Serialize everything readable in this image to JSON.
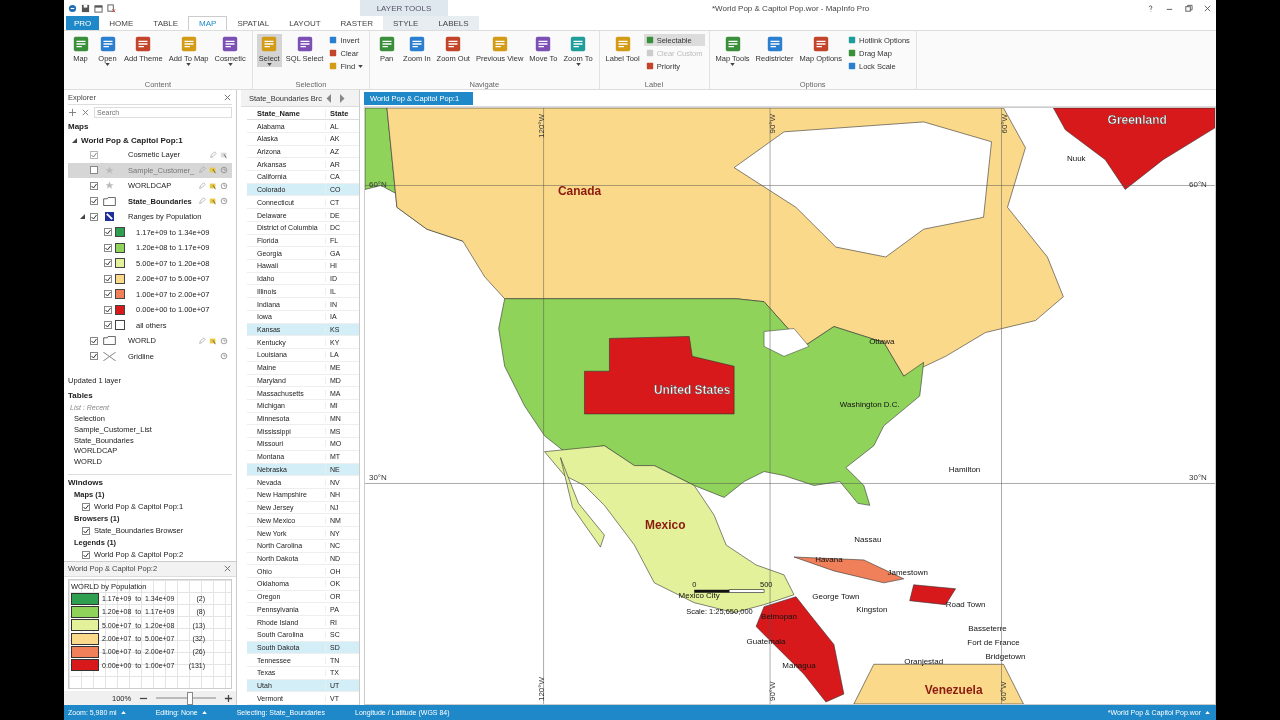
{
  "title_bar": {
    "title": "*World Pop & Capitol Pop.wor - MapInfo Pro",
    "context_group": "LAYER TOOLS"
  },
  "ribbon_tabs": [
    {
      "label": "PRO",
      "kind": "file",
      "selected": false
    },
    {
      "label": "HOME",
      "kind": "main",
      "selected": false
    },
    {
      "label": "TABLE",
      "kind": "main",
      "selected": false
    },
    {
      "label": "MAP",
      "kind": "main",
      "selected": true
    },
    {
      "label": "SPATIAL",
      "kind": "main",
      "selected": false
    },
    {
      "label": "LAYOUT",
      "kind": "main",
      "selected": false
    },
    {
      "label": "RASTER",
      "kind": "main",
      "selected": false
    },
    {
      "label": "STYLE",
      "kind": "context",
      "selected": false
    },
    {
      "label": "LABELS",
      "kind": "context",
      "selected": false
    }
  ],
  "ribbon_groups": [
    {
      "label": "Content",
      "buttons": [
        {
          "label": "Map",
          "kind": "large",
          "selected": false,
          "disabled": false,
          "dropdown": false
        },
        {
          "label": "Open",
          "kind": "large",
          "selected": false,
          "disabled": false,
          "dropdown": true
        },
        {
          "label": "Add Theme",
          "kind": "large",
          "selected": false,
          "disabled": false,
          "dropdown": false
        },
        {
          "label": "Add To Map",
          "kind": "large",
          "selected": false,
          "disabled": false,
          "dropdown": true
        },
        {
          "label": "Cosmetic",
          "kind": "large",
          "selected": false,
          "disabled": false,
          "dropdown": true
        }
      ]
    },
    {
      "label": "Selection",
      "buttons": [
        {
          "label": "Select",
          "kind": "large",
          "selected": true,
          "disabled": false,
          "dropdown": true
        },
        {
          "label": "SQL Select",
          "kind": "large",
          "selected": false,
          "disabled": false,
          "dropdown": false
        },
        {
          "label": "Invert",
          "kind": "small",
          "selected": false,
          "disabled": false,
          "dropdown": false
        },
        {
          "label": "Clear",
          "kind": "small",
          "selected": false,
          "disabled": false,
          "dropdown": false
        },
        {
          "label": "Find",
          "kind": "small",
          "selected": false,
          "disabled": false,
          "dropdown": true
        }
      ]
    },
    {
      "label": "Navigate",
      "buttons": [
        {
          "label": "Pan",
          "kind": "large",
          "selected": false,
          "disabled": false,
          "dropdown": false
        },
        {
          "label": "Zoom In",
          "kind": "large",
          "selected": false,
          "disabled": false,
          "dropdown": false
        },
        {
          "label": "Zoom Out",
          "kind": "large",
          "selected": false,
          "disabled": false,
          "dropdown": false
        },
        {
          "label": "Previous View",
          "kind": "large",
          "selected": false,
          "disabled": false,
          "dropdown": false
        },
        {
          "label": "Move To",
          "kind": "large",
          "selected": false,
          "disabled": false,
          "dropdown": false
        },
        {
          "label": "Zoom To",
          "kind": "large",
          "selected": false,
          "disabled": false,
          "dropdown": true
        }
      ]
    },
    {
      "label": "Label",
      "buttons": [
        {
          "label": "Label Tool",
          "kind": "large",
          "selected": false,
          "disabled": false,
          "dropdown": false
        },
        {
          "label": "Selectable",
          "kind": "small",
          "selected": true,
          "disabled": false,
          "dropdown": false
        },
        {
          "label": "Clear Custom",
          "kind": "small",
          "selected": false,
          "disabled": true,
          "dropdown": false
        },
        {
          "label": "Priority",
          "kind": "small",
          "selected": false,
          "disabled": false,
          "dropdown": false
        }
      ]
    },
    {
      "label": "Options",
      "buttons": [
        {
          "label": "Map Tools",
          "kind": "large",
          "selected": false,
          "disabled": false,
          "dropdown": true
        },
        {
          "label": "Redistricter",
          "kind": "large",
          "selected": false,
          "disabled": false,
          "dropdown": false
        },
        {
          "label": "Map Options",
          "kind": "large",
          "selected": false,
          "disabled": false,
          "dropdown": false
        },
        {
          "label": "Hotlink Options",
          "kind": "small",
          "selected": false,
          "disabled": false,
          "dropdown": false
        },
        {
          "label": "Drag Map",
          "kind": "small",
          "selected": false,
          "disabled": false,
          "dropdown": false
        },
        {
          "label": "Lock Scale",
          "kind": "small",
          "selected": false,
          "disabled": false,
          "dropdown": false
        }
      ]
    }
  ],
  "explorer": {
    "title": "Explorer",
    "search": {
      "placeholder": "Search"
    },
    "maps_header": "Maps",
    "map": {
      "label": "World Pop & Capitol Pop:1",
      "expanded": true,
      "layers": [
        {
          "label": "Cosmetic Layer",
          "kind": "cosmetic",
          "checked": true,
          "selected": false,
          "editable": false
        },
        {
          "label": "Sample_Customer_",
          "kind": "point",
          "checked": false,
          "selected": true,
          "editable": false
        },
        {
          "label": "WORLDCAP",
          "kind": "point",
          "checked": true,
          "selected": false,
          "editable": false
        },
        {
          "label": "State_Boundaries",
          "kind": "region",
          "checked": true,
          "selected": false,
          "editable": true
        },
        {
          "label": "Ranges by Population",
          "kind": "theme",
          "checked": true,
          "selected": false,
          "editable": false,
          "expanded": true,
          "children": [
            {
              "label": "1.17e+09 to 1.34e+09",
              "color": "#2e9e4f",
              "checked": true
            },
            {
              "label": "1.20e+08 to 1.17e+09",
              "color": "#8fd35a",
              "checked": true
            },
            {
              "label": "5.00e+07 to 1.20e+08",
              "color": "#e3f29a",
              "checked": true
            },
            {
              "label": "2.00e+07 to 5.00e+07",
              "color": "#fbd98a",
              "checked": true
            },
            {
              "label": "1.00e+07 to 2.00e+07",
              "color": "#f0805a",
              "checked": true
            },
            {
              "label": "0.00e+00 to 1.00e+07",
              "color": "#d7191c",
              "checked": true
            },
            {
              "label": "all others",
              "color": "#ffffff",
              "checked": true
            }
          ]
        },
        {
          "label": "WORLD",
          "kind": "region",
          "checked": true,
          "selected": false,
          "editable": false
        },
        {
          "label": "Gridline",
          "kind": "gridline",
          "checked": true,
          "selected": false,
          "editable": false
        }
      ]
    },
    "message": "Updated 1 layer",
    "tables_header": "Tables",
    "tables_list_mode": "List : Recent",
    "tables": [
      "Selection",
      "Sample_Customer_List",
      "State_Boundaries",
      "WORLDCAP",
      "WORLD"
    ],
    "windows_header": "Windows",
    "window_groups": [
      {
        "label": "Maps (1)",
        "items": [
          {
            "label": "World Pop & Capitol Pop:1",
            "checked": true
          }
        ]
      },
      {
        "label": "Browsers (1)",
        "items": [
          {
            "label": "State_Boundaries Browser",
            "checked": true
          }
        ]
      },
      {
        "label": "Legends (1)",
        "items": [
          {
            "label": "World Pop & Capitol Pop:2",
            "checked": true
          }
        ]
      }
    ]
  },
  "legend": {
    "title": "World Pop & Capitol Pop:2",
    "heading": "WORLD by Population",
    "rows": [
      {
        "color": "#2e9e4f",
        "range": "1.17e+09  to  1.34e+09",
        "count": "(2)"
      },
      {
        "color": "#8fd35a",
        "range": "1.20e+08  to  1.17e+09",
        "count": "(8)"
      },
      {
        "color": "#e3f29a",
        "range": "5.00e+07  to  1.20e+08",
        "count": "(13)"
      },
      {
        "color": "#fbd98a",
        "range": "2.00e+07  to  5.00e+07",
        "count": "(32)"
      },
      {
        "color": "#f0805a",
        "range": "1.00e+07  to  2.00e+07",
        "count": "(26)"
      },
      {
        "color": "#d7191c",
        "range": "0.00e+00  to  1.00e+07",
        "count": "(131)"
      }
    ],
    "zoom": "100%",
    "zoom_slider": {
      "level": 0.55
    }
  },
  "browser": {
    "tab": "State_Boundaries Brc",
    "columns": [
      "State_Name",
      "State"
    ],
    "rows": [
      {
        "name": "Alabama",
        "code": "AL",
        "selected": false
      },
      {
        "name": "Alaska",
        "code": "AK",
        "selected": false
      },
      {
        "name": "Arizona",
        "code": "AZ",
        "selected": false
      },
      {
        "name": "Arkansas",
        "code": "AR",
        "selected": false
      },
      {
        "name": "California",
        "code": "CA",
        "selected": false
      },
      {
        "name": "Colorado",
        "code": "CO",
        "selected": true
      },
      {
        "name": "Connecticut",
        "code": "CT",
        "selected": false
      },
      {
        "name": "Delaware",
        "code": "DE",
        "selected": false
      },
      {
        "name": "District of Columbia",
        "code": "DC",
        "selected": false
      },
      {
        "name": "Florida",
        "code": "FL",
        "selected": false
      },
      {
        "name": "Georgia",
        "code": "GA",
        "selected": false
      },
      {
        "name": "Hawaii",
        "code": "HI",
        "selected": false
      },
      {
        "name": "Idaho",
        "code": "ID",
        "selected": false
      },
      {
        "name": "Illinois",
        "code": "IL",
        "selected": false
      },
      {
        "name": "Indiana",
        "code": "IN",
        "selected": false
      },
      {
        "name": "Iowa",
        "code": "IA",
        "selected": false
      },
      {
        "name": "Kansas",
        "code": "KS",
        "selected": true
      },
      {
        "name": "Kentucky",
        "code": "KY",
        "selected": false
      },
      {
        "name": "Louisiana",
        "code": "LA",
        "selected": false
      },
      {
        "name": "Maine",
        "code": "ME",
        "selected": false
      },
      {
        "name": "Maryland",
        "code": "MD",
        "selected": false
      },
      {
        "name": "Massachusetts",
        "code": "MA",
        "selected": false
      },
      {
        "name": "Michigan",
        "code": "MI",
        "selected": false
      },
      {
        "name": "Minnesota",
        "code": "MN",
        "selected": false
      },
      {
        "name": "Mississippi",
        "code": "MS",
        "selected": false
      },
      {
        "name": "Missouri",
        "code": "MO",
        "selected": false
      },
      {
        "name": "Montana",
        "code": "MT",
        "selected": false
      },
      {
        "name": "Nebraska",
        "code": "NE",
        "selected": true
      },
      {
        "name": "Nevada",
        "code": "NV",
        "selected": false
      },
      {
        "name": "New Hampshire",
        "code": "NH",
        "selected": false
      },
      {
        "name": "New Jersey",
        "code": "NJ",
        "selected": false
      },
      {
        "name": "New Mexico",
        "code": "NM",
        "selected": false
      },
      {
        "name": "New York",
        "code": "NY",
        "selected": false
      },
      {
        "name": "North Carolina",
        "code": "NC",
        "selected": false
      },
      {
        "name": "North Dakota",
        "code": "ND",
        "selected": false
      },
      {
        "name": "Ohio",
        "code": "OH",
        "selected": false
      },
      {
        "name": "Oklahoma",
        "code": "OK",
        "selected": false
      },
      {
        "name": "Oregon",
        "code": "OR",
        "selected": false
      },
      {
        "name": "Pennsylvania",
        "code": "PA",
        "selected": false
      },
      {
        "name": "Rhode Island",
        "code": "RI",
        "selected": false
      },
      {
        "name": "South Carolina",
        "code": "SC",
        "selected": false
      },
      {
        "name": "South Dakota",
        "code": "SD",
        "selected": true
      },
      {
        "name": "Tennessee",
        "code": "TN",
        "selected": false
      },
      {
        "name": "Texas",
        "code": "TX",
        "selected": false
      },
      {
        "name": "Utah",
        "code": "UT",
        "selected": true
      },
      {
        "name": "Vermont",
        "code": "VT",
        "selected": false
      }
    ]
  },
  "map": {
    "tab": "World Pop & Capitol Pop:1",
    "labels": [
      {
        "text": "Greenland",
        "kind": "country-inverse"
      },
      {
        "text": "Canada",
        "kind": "country"
      },
      {
        "text": "United States",
        "kind": "country-inverse"
      },
      {
        "text": "Mexico",
        "kind": "country"
      },
      {
        "text": "Venezuela",
        "kind": "country"
      },
      {
        "text": "Nuuk",
        "kind": "city"
      },
      {
        "text": "Ottawa",
        "kind": "city"
      },
      {
        "text": "Washington D.C.",
        "kind": "city"
      },
      {
        "text": "Hamilton",
        "kind": "city"
      },
      {
        "text": "Nassau",
        "kind": "city"
      },
      {
        "text": "Havana",
        "kind": "city"
      },
      {
        "text": "Jamestown",
        "kind": "city"
      },
      {
        "text": "George Town",
        "kind": "city"
      },
      {
        "text": "Kingston",
        "kind": "city"
      },
      {
        "text": "Road Town",
        "kind": "city"
      },
      {
        "text": "Basseterre",
        "kind": "city"
      },
      {
        "text": "Fort de France",
        "kind": "city"
      },
      {
        "text": "Bridgetown",
        "kind": "city"
      },
      {
        "text": "Oranjestad",
        "kind": "city"
      },
      {
        "text": "Mexico City",
        "kind": "city"
      },
      {
        "text": "Belmopan",
        "kind": "city"
      },
      {
        "text": "Guatemala",
        "kind": "city"
      },
      {
        "text": "Managua",
        "kind": "city"
      },
      {
        "text": "60°N",
        "kind": "latitude"
      },
      {
        "text": "60°N",
        "kind": "latitude"
      },
      {
        "text": "30°N",
        "kind": "latitude"
      },
      {
        "text": "30°N",
        "kind": "latitude"
      },
      {
        "text": "120°W",
        "kind": "longitude"
      },
      {
        "text": "90°W",
        "kind": "longitude"
      },
      {
        "text": "60°W",
        "kind": "longitude"
      },
      {
        "text": "120°W",
        "kind": "longitude"
      },
      {
        "text": "90°W",
        "kind": "longitude"
      },
      {
        "text": "60°W",
        "kind": "longitude"
      }
    ],
    "scale_bar": {
      "start": "0",
      "end": "500",
      "text": "Scale: 1:25,650,000"
    }
  },
  "status_bar": {
    "items": [
      {
        "text": "Zoom: 5,980 mi",
        "menu": true
      },
      {
        "text": "Editing: None",
        "menu": true
      },
      {
        "text": "Selecting: State_Boundaries",
        "menu": false
      },
      {
        "text": "Longitude / Latitude (WGS 84)",
        "menu": false
      }
    ],
    "workspace": {
      "text": "*World Pop & Capitol Pop.wor",
      "menu": true
    }
  }
}
